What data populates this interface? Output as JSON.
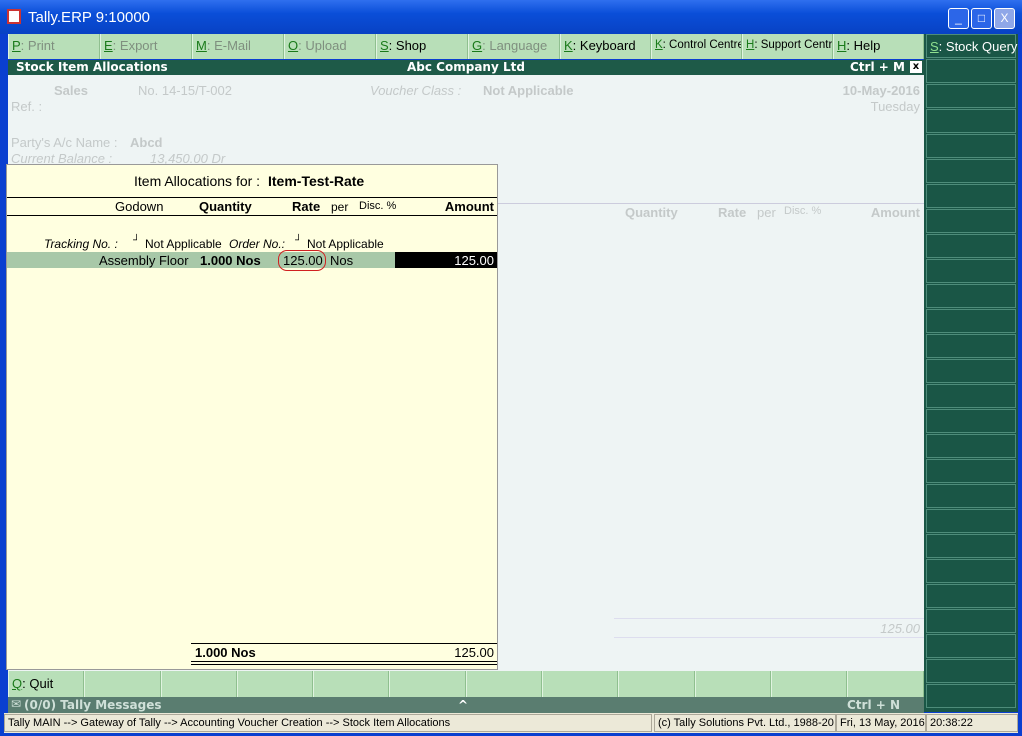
{
  "window": {
    "title": "Tally.ERP 9:10000",
    "min": "_",
    "max": "□",
    "close": "X"
  },
  "menu": [
    {
      "key": "P",
      "label": ": Print",
      "disabled": true
    },
    {
      "key": "E",
      "label": ": Export",
      "disabled": true
    },
    {
      "key": "M",
      "label": ": E-Mail",
      "disabled": true
    },
    {
      "key": "O",
      "label": ": Upload",
      "disabled": true
    },
    {
      "key": "S",
      "label": ": Shop",
      "disabled": false
    },
    {
      "key": "G",
      "label": ": Language",
      "disabled": true
    },
    {
      "key": "K",
      "label": ": Keyboard",
      "disabled": false
    },
    {
      "key": "K",
      "label": ": Control Centre",
      "disabled": false
    },
    {
      "key": "H",
      "label": ": Support Centre",
      "disabled": false
    },
    {
      "key": "H",
      "label": ": Help",
      "disabled": false
    }
  ],
  "right_panel": {
    "key": "S",
    "label": ": Stock Query"
  },
  "header": {
    "left": "Stock Item Allocations",
    "center": "Abc Company Ltd",
    "right": "Ctrl + M",
    "close": "x"
  },
  "voucher": {
    "type": "Sales",
    "no": "No. 14-15/T-002",
    "class_label": "Voucher Class :",
    "class_value": "Not Applicable",
    "date": "10-May-2016",
    "day": "Tuesday",
    "ref": "Ref. :",
    "party_label": "Party's A/c Name  :",
    "party": "Abcd",
    "balance_label": "Current Balance   :",
    "balance": "13,450.00 Dr",
    "cols": {
      "quantity": "Quantity",
      "rate": "Rate",
      "per": "per",
      "disc": "Disc. %",
      "amount": "Amount"
    },
    "total": "125.00"
  },
  "popup": {
    "title_label": "Item Allocations for :",
    "item": "Item-Test-Rate",
    "cols": {
      "godown": "Godown",
      "quantity": "Quantity",
      "rate": "Rate",
      "per": "per",
      "disc": "Disc. %",
      "amount": "Amount"
    },
    "tracking_label": "Tracking No. :",
    "tracking_value": "Not Applicable",
    "order_label": "Order No.:",
    "order_value": "Not Applicable",
    "row": {
      "godown": "Assembly Floor",
      "quantity": "1.000 Nos",
      "rate": "125.00",
      "per": "Nos",
      "amount": "125.00"
    },
    "total_qty": "1.000 Nos",
    "total_amount": "125.00"
  },
  "bottom": {
    "key": "Q",
    "label": ": Quit"
  },
  "messages": {
    "label": "(0/0) Tally Messages",
    "caret": "^",
    "shortcut": "Ctrl + N"
  },
  "status": {
    "path": "Tally MAIN --> Gateway of Tally --> Accounting Voucher  Creation  --> Stock Item Allocations",
    "copyright": "(c) Tally Solutions Pvt. Ltd., 1988-20",
    "date": "Fri, 13 May, 2016",
    "time": "20:38:22"
  },
  "colors": {
    "menu": "#b8dfb8",
    "dark_green": "#1e5a48",
    "popup": "#ffffe0",
    "highlight": "#a8c8a8",
    "marker": "#d02020"
  }
}
